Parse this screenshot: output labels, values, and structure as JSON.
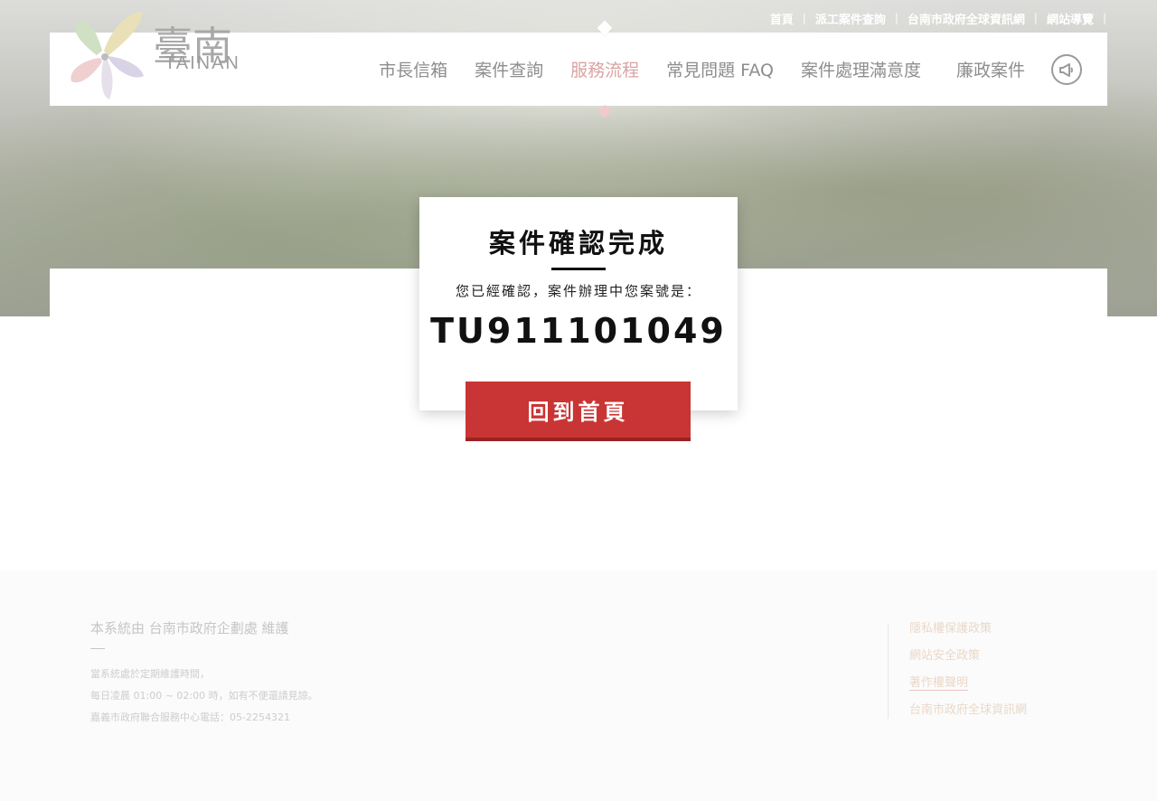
{
  "top_links": [
    "首頁",
    "派工案件查詢",
    "台南市政府全球資訊網",
    "網站導覽"
  ],
  "logo": {
    "text": "TAINAN",
    "glyphs": "臺南"
  },
  "nav": {
    "items": [
      "市長信箱",
      "案件查詢",
      "服務流程",
      "常見問題 FAQ",
      "案件處理滿意度",
      "廉政案件"
    ],
    "active": "服務流程",
    "announce_icon": "megaphone-icon"
  },
  "modal": {
    "title": "案件確認完成",
    "message": "您已經確認，案件辦理中您案號是：",
    "case_number": "TU911101049"
  },
  "home_button": {
    "label": "回到首頁"
  },
  "footer": {
    "title": "本系統由 台南市政府企劃處 維護",
    "notes": [
      "當系統處於定期維護時間，",
      "每日凌晨 01:00 ~ 02:00 時，如有不便還請見諒。",
      "嘉義市政府聯合服務中心電話：05-2254321"
    ],
    "links": [
      "隱私權保護政策",
      "網站安全政策",
      "著作權聲明",
      "台南市政府全球資訊網"
    ]
  },
  "colors": {
    "accent": "#c93535",
    "nav_active": "#d9a3a3",
    "footer_link": "#ead8c9"
  }
}
